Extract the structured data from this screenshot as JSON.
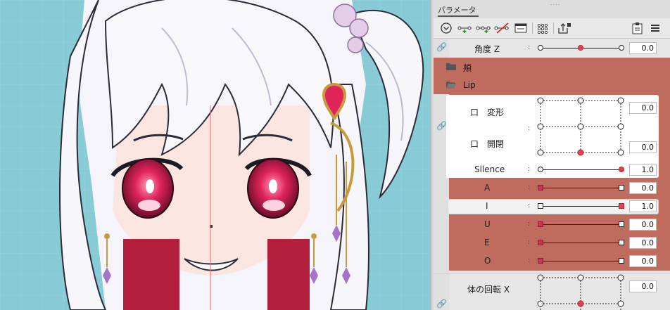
{
  "panel": {
    "title": "パラメータ",
    "grip": "....",
    "toolbar_icons": [
      "chevron-circle-icon",
      "add-key-icon",
      "add-multi-key-icon",
      "remove-key-icon",
      "window-icon",
      "dots-grid-icon",
      "export-lock-icon",
      "clipboard-icon",
      "menu-icon"
    ]
  },
  "params": {
    "kaku_z": {
      "label": "角度 Z",
      "value": "0.0"
    },
    "folder_cheek": {
      "label": "頬"
    },
    "folder_lip": {
      "label": "Lip"
    },
    "kuchi_henkei": {
      "label": "口　変形",
      "value": "0.0"
    },
    "kuchi_kaihei": {
      "label": "口　開閉",
      "value": "0.0"
    },
    "silence": {
      "label": "Silence",
      "value": "1.0"
    },
    "a": {
      "label": "A",
      "value": "0.0"
    },
    "i": {
      "label": "I",
      "value": "1.0"
    },
    "u": {
      "label": "U",
      "value": "0.0"
    },
    "e": {
      "label": "E",
      "value": "0.0"
    },
    "o": {
      "label": "O",
      "value": "0.0"
    },
    "body_x": {
      "label": "体の回転 X",
      "value": "0.0"
    }
  },
  "colon": ":",
  "colors": {
    "accent_red": "#e5405a",
    "folder": "#bf6b5e",
    "canvas_bg": "#86cbd6"
  }
}
